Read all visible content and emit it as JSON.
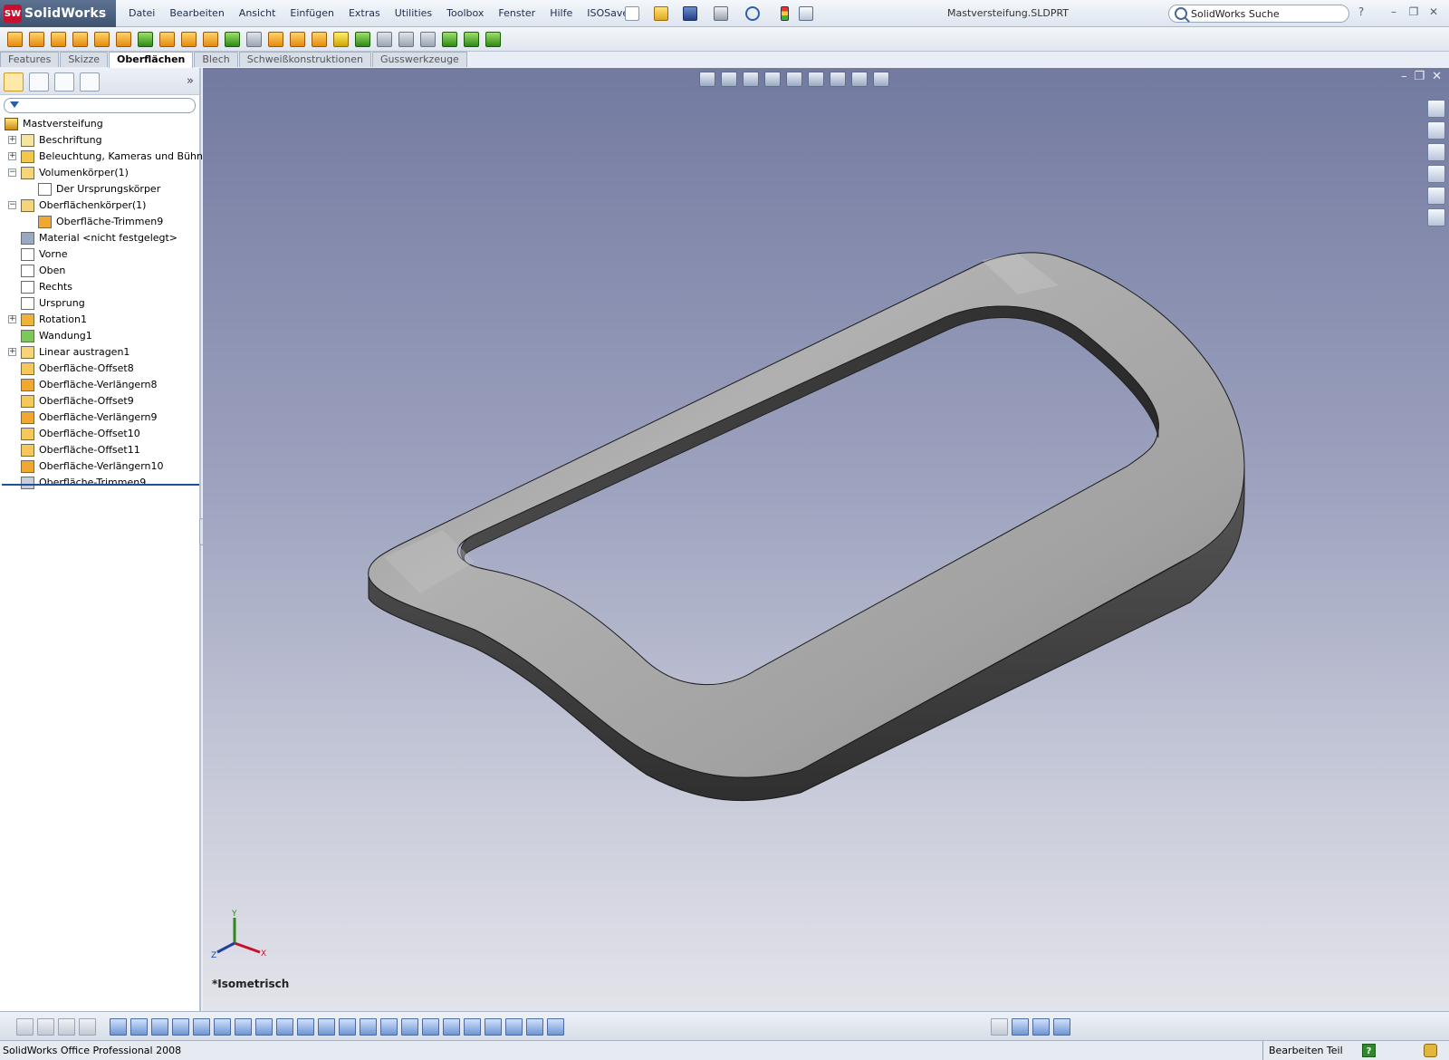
{
  "app": {
    "brand_badge": "SW",
    "brand": "SolidWorks",
    "document_title": "Mastversteifung.SLDPRT"
  },
  "menu": [
    "Datei",
    "Bearbeiten",
    "Ansicht",
    "Einfügen",
    "Extras",
    "Utilities",
    "Toolbox",
    "Fenster",
    "Hilfe",
    "ISOSave"
  ],
  "search": {
    "value": "SolidWorks Suche",
    "placeholder": "SolidWorks Suche"
  },
  "window_controls": {
    "help": "?",
    "minimize": "–",
    "restore": "❐",
    "close": "✕"
  },
  "command_tabs": [
    {
      "label": "Features",
      "active": false
    },
    {
      "label": "Skizze",
      "active": false
    },
    {
      "label": "Oberflächen",
      "active": true
    },
    {
      "label": "Blech",
      "active": false
    },
    {
      "label": "Schweißkonstruktionen",
      "active": false
    },
    {
      "label": "Gusswerkzeuge",
      "active": false
    }
  ],
  "feature_tree": {
    "expand_symbol": "»",
    "root": "Mastversteifung",
    "items": [
      {
        "label": "Beschriftung",
        "expander": "+",
        "icon": "annotation-icon"
      },
      {
        "label": "Beleuchtung, Kameras und Bühne",
        "expander": "+",
        "icon": "lights-cameras-icon"
      },
      {
        "label": "Volumenkörper(1)",
        "expander": "−",
        "icon": "solid-bodies-folder-icon"
      },
      {
        "label": "Der Ursprungskörper",
        "expander": "",
        "icon": "solid-body-icon",
        "indent": true
      },
      {
        "label": "Oberflächenkörper(1)",
        "expander": "−",
        "icon": "surface-bodies-folder-icon"
      },
      {
        "label": "Oberfläche-Trimmen9",
        "expander": "",
        "icon": "surface-body-icon",
        "indent": true
      },
      {
        "label": "Material <nicht festgelegt>",
        "expander": "",
        "icon": "material-icon"
      },
      {
        "label": "Vorne",
        "expander": "",
        "icon": "plane-icon"
      },
      {
        "label": "Oben",
        "expander": "",
        "icon": "plane-icon"
      },
      {
        "label": "Rechts",
        "expander": "",
        "icon": "plane-icon"
      },
      {
        "label": "Ursprung",
        "expander": "",
        "icon": "origin-icon"
      },
      {
        "label": "Rotation1",
        "expander": "+",
        "icon": "revolve-icon"
      },
      {
        "label": "Wandung1",
        "expander": "",
        "icon": "shell-icon"
      },
      {
        "label": "Linear austragen1",
        "expander": "+",
        "icon": "extrude-icon"
      },
      {
        "label": "Oberfläche-Offset8",
        "expander": "",
        "icon": "surface-offset-icon"
      },
      {
        "label": "Oberfläche-Verlängern8",
        "expander": "",
        "icon": "surface-extend-icon"
      },
      {
        "label": "Oberfläche-Offset9",
        "expander": "",
        "icon": "surface-offset-icon"
      },
      {
        "label": "Oberfläche-Verlängern9",
        "expander": "",
        "icon": "surface-extend-icon"
      },
      {
        "label": "Oberfläche-Offset10",
        "expander": "",
        "icon": "surface-offset-icon"
      },
      {
        "label": "Oberfläche-Offset11",
        "expander": "",
        "icon": "surface-offset-icon"
      },
      {
        "label": "Oberfläche-Verlängern10",
        "expander": "",
        "icon": "surface-extend-icon"
      },
      {
        "label": "Oberfläche-Trimmen9",
        "expander": "",
        "icon": "surface-trim-icon"
      }
    ]
  },
  "viewport": {
    "view_label": "*Isometrisch",
    "triad": {
      "x": "X",
      "y": "Y",
      "z": "Z"
    },
    "controls": {
      "minimize": "–",
      "restore": "❐",
      "close": "✕"
    }
  },
  "status": {
    "product": "SolidWorks Office Professional 2008",
    "mode": "Bearbeiten Teil",
    "help_badge": "?"
  }
}
